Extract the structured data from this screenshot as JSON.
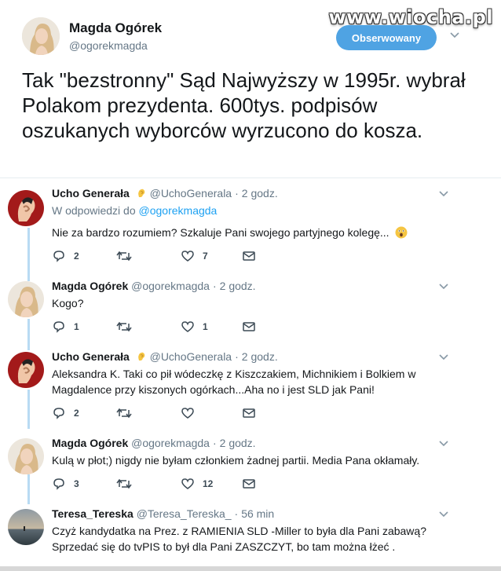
{
  "watermark": "www.wiocha.pl",
  "main_tweet": {
    "author_name": "Magda Ogórek",
    "author_handle": "@ogorekmagda",
    "follow_label": "Obserwowany",
    "text": "Tak \"bezstronny\" Sąd Najwyższy w 1995r. wybrał Polakom prezydenta. 600tys. podpisów oszukanych wyborców wyrzucono do kosza."
  },
  "replies": [
    {
      "name": "Ucho Generała",
      "handle": "@UchoGenerala",
      "time": "2 godz.",
      "reply_prefix": "W odpowiedzi do",
      "reply_to": "@ogorekmagda",
      "text": "Nie za bardzo rozumiem? Szkaluje Pani swojego partyjnego kolegę...",
      "replies_count": "2",
      "retweets_count": "",
      "likes_count": "7"
    },
    {
      "name": "Magda Ogórek",
      "handle": "@ogorekmagda",
      "time": "2 godz.",
      "text": "Kogo?",
      "replies_count": "1",
      "retweets_count": "",
      "likes_count": "1"
    },
    {
      "name": "Ucho Generała",
      "handle": "@UchoGenerala",
      "time": "2 godz.",
      "text": "Aleksandra K. Taki co pił wódeczkę z Kiszczakiem, Michnikiem i Bolkiem w Magdalence przy kiszonych ogórkach...Aha no i jest SLD jak Pani!",
      "replies_count": "2",
      "retweets_count": "",
      "likes_count": ""
    },
    {
      "name": "Magda Ogórek",
      "handle": "@ogorekmagda",
      "time": "2 godz.",
      "text": "Kulą w płot;) nigdy nie byłam członkiem żadnej partii. Media Pana okłamały.",
      "replies_count": "3",
      "retweets_count": "",
      "likes_count": "12"
    },
    {
      "name": "Teresa_Tereska",
      "handle": "@Teresa_Tereska_",
      "time": "56 min",
      "text": "Czyż kandydatka na Prez. z RAMIENIA SLD -Miller to była dla Pani zabawą? Sprzedać się do tvPIS to był dla Pani ZASZCZYT, bo tam można łżeć ."
    }
  ],
  "separator": "·",
  "colors": {
    "accent": "#1da1f2",
    "follow_button": "#4fa3e3",
    "thread_line": "#b8dbf3",
    "muted_text": "#657786"
  },
  "icons": [
    "chevron-down-icon",
    "reply-icon",
    "retweet-icon",
    "like-icon",
    "dm-icon",
    "ear-emoji",
    "astonished-emoji"
  ]
}
